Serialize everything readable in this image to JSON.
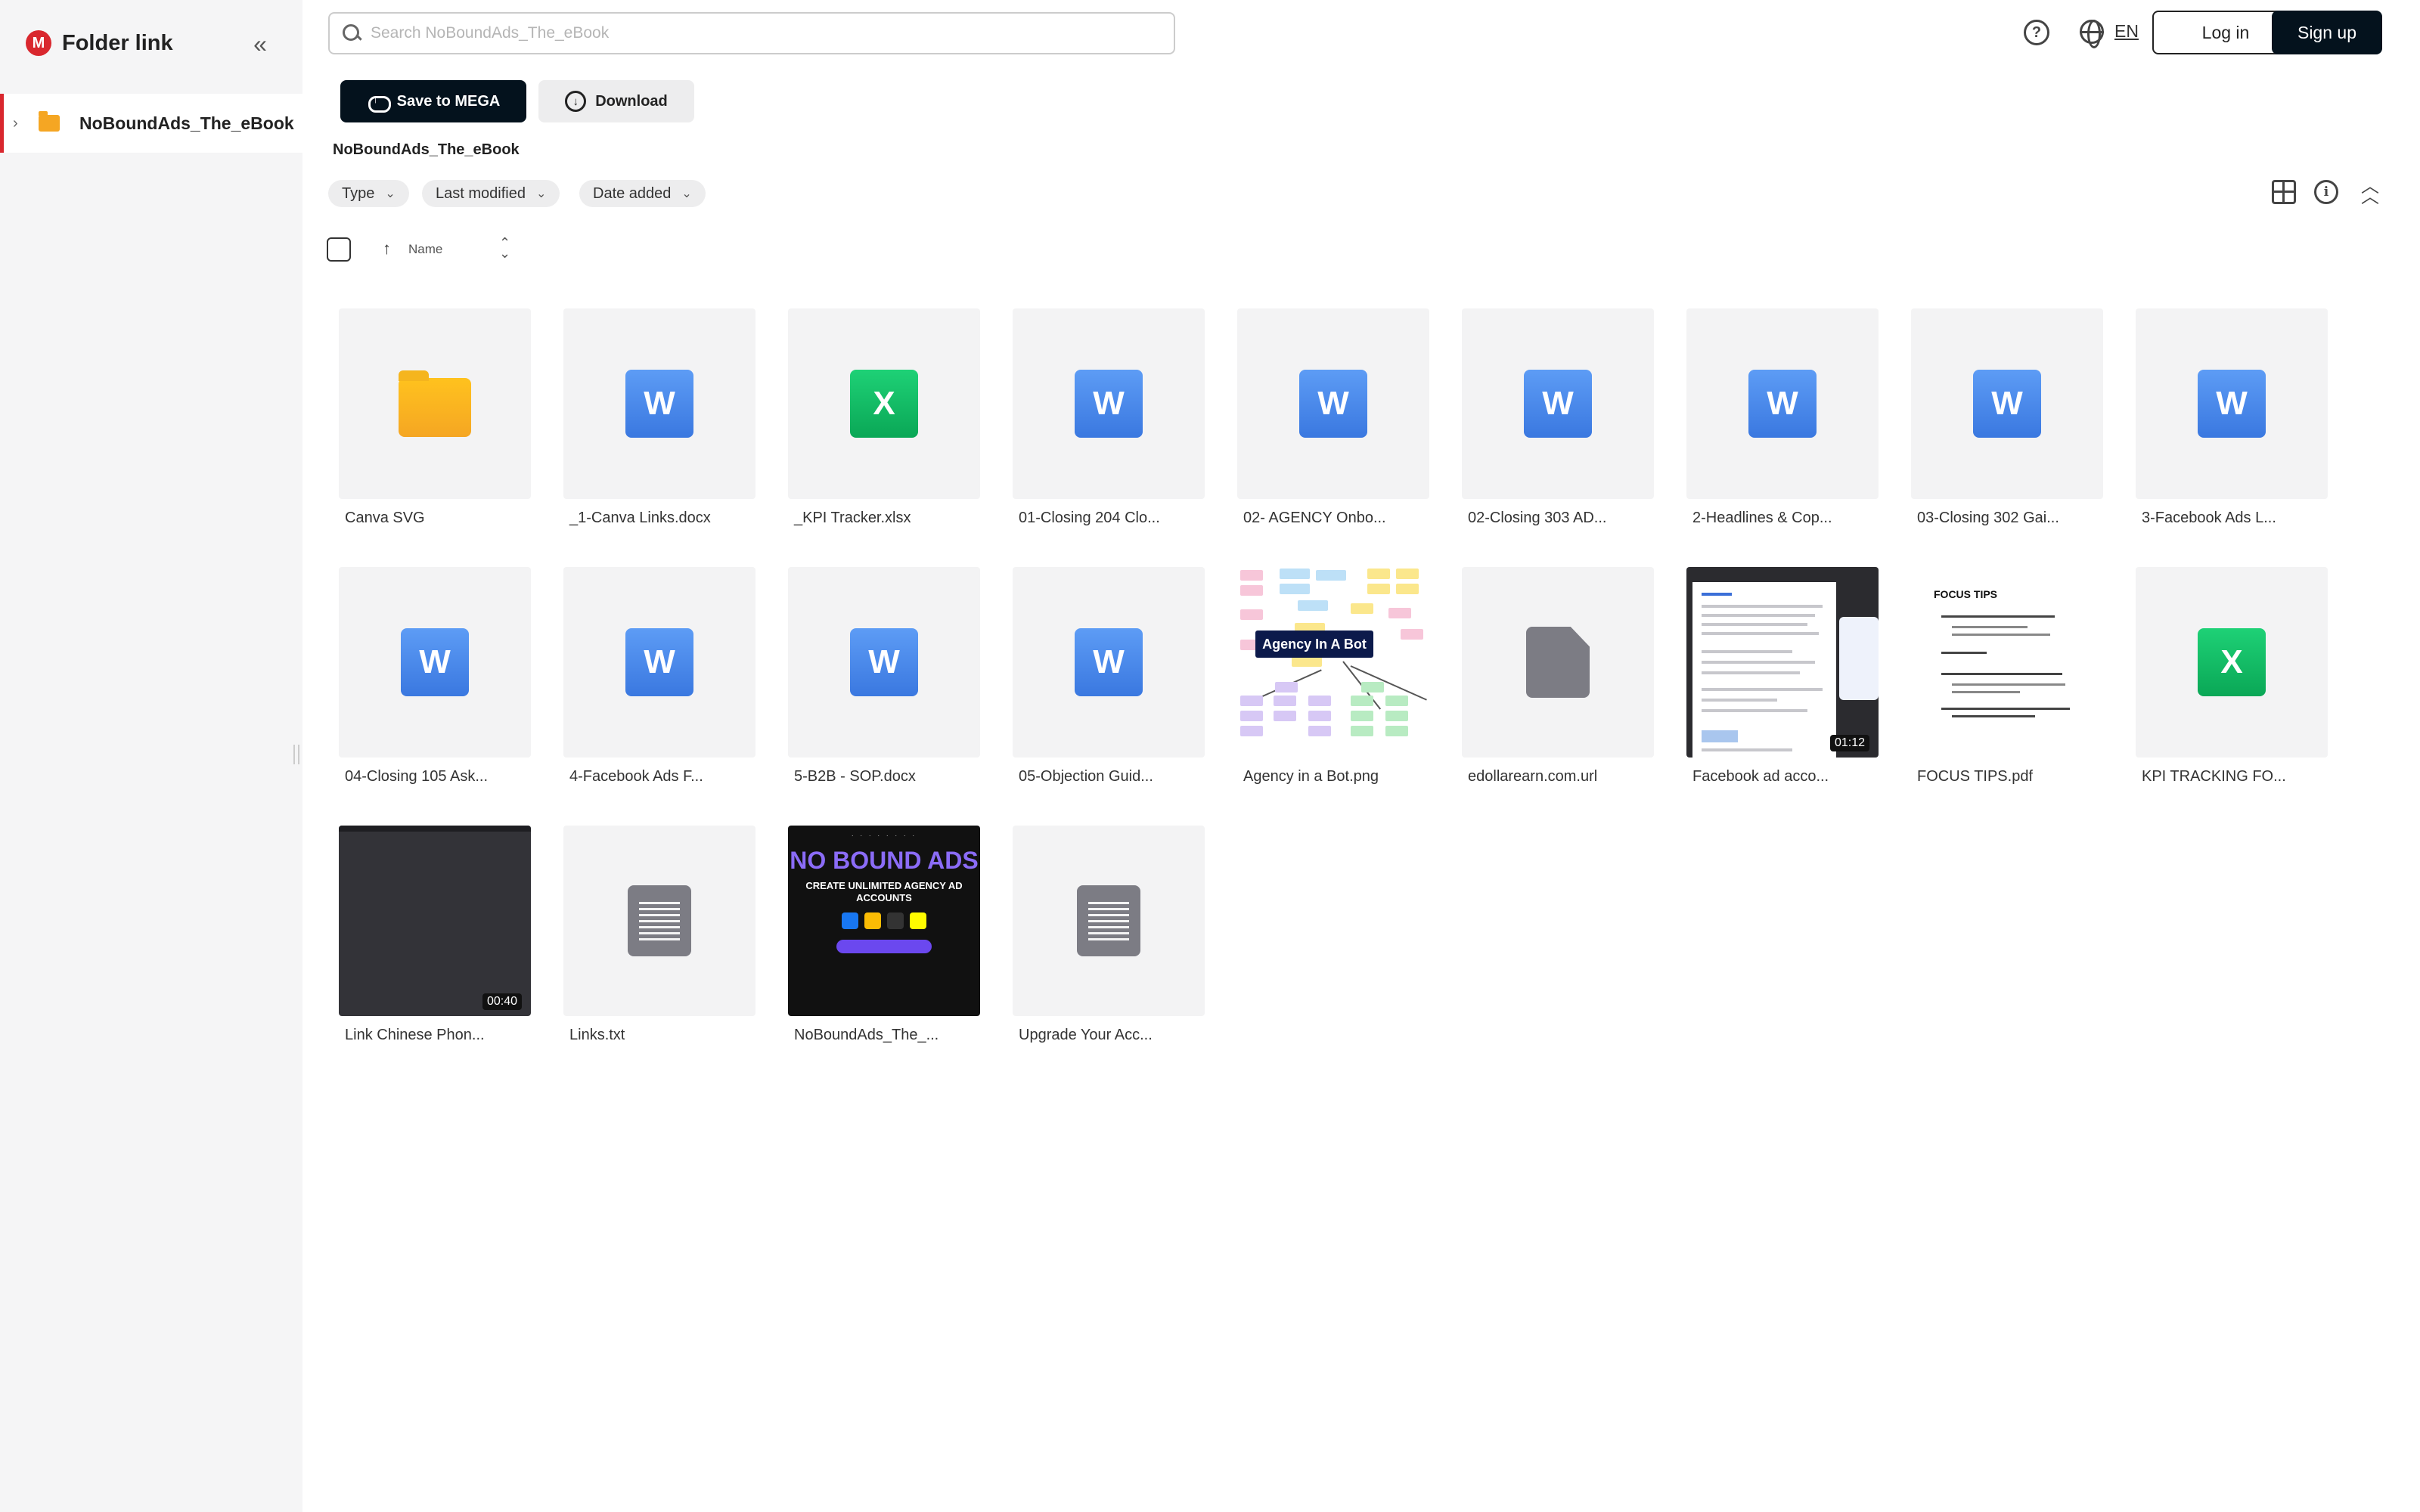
{
  "app": {
    "brand_logo": "M",
    "brand_title": "Folder link",
    "accent_color": "#d9272e"
  },
  "sidebar": {
    "items": [
      {
        "label": "NoBoundAds_The_eBook",
        "icon": "folder-icon"
      }
    ]
  },
  "header": {
    "search_placeholder": "Search NoBoundAds_The_eBook",
    "language": "EN",
    "login_label": "Log in",
    "signup_label": "Sign up"
  },
  "actions": {
    "save_label": "Save to MEGA",
    "download_label": "Download"
  },
  "breadcrumb": "NoBoundAds_The_eBook",
  "filters": [
    {
      "label": "Type"
    },
    {
      "label": "Last modified"
    },
    {
      "label": "Date added"
    }
  ],
  "sort": {
    "label": "Name",
    "direction": "ascending"
  },
  "files": [
    {
      "name": "Canva SVG",
      "kind": "folder"
    },
    {
      "name": "_1-Canva Links.docx",
      "kind": "word"
    },
    {
      "name": "_KPI Tracker.xlsx",
      "kind": "excel"
    },
    {
      "name": "01-Closing 204 Clo...",
      "kind": "word"
    },
    {
      "name": "02- AGENCY Onbo...",
      "kind": "word"
    },
    {
      "name": "02-Closing 303 AD...",
      "kind": "word"
    },
    {
      "name": "2-Headlines & Cop...",
      "kind": "word"
    },
    {
      "name": "03-Closing 302 Gai...",
      "kind": "word"
    },
    {
      "name": "3-Facebook Ads L...",
      "kind": "word"
    },
    {
      "name": "04-Closing 105 Ask...",
      "kind": "word"
    },
    {
      "name": "4-Facebook Ads F...",
      "kind": "word"
    },
    {
      "name": "5-B2B - SOP.docx",
      "kind": "word"
    },
    {
      "name": "05-Objection Guid...",
      "kind": "word"
    },
    {
      "name": "Agency in a Bot.png",
      "kind": "image-mindmap",
      "thumb_text": "Agency In A Bot"
    },
    {
      "name": "edollarearn.com.url",
      "kind": "generic"
    },
    {
      "name": "Facebook ad acco...",
      "kind": "video-screenshot",
      "duration": "01:12"
    },
    {
      "name": "FOCUS TIPS.pdf",
      "kind": "pdf",
      "thumb_text": "FOCUS TIPS"
    },
    {
      "name": "KPI TRACKING FO...",
      "kind": "excel"
    },
    {
      "name": "Link Chinese Phon...",
      "kind": "video-dark",
      "duration": "00:40"
    },
    {
      "name": "Links.txt",
      "kind": "text"
    },
    {
      "name": "NoBoundAds_The_...",
      "kind": "image-cover",
      "cover_title": "NO BOUND ADS",
      "cover_sub": "CREATE UNLIMITED AGENCY AD ACCOUNTS"
    },
    {
      "name": "Upgrade Your Acc...",
      "kind": "text"
    }
  ]
}
